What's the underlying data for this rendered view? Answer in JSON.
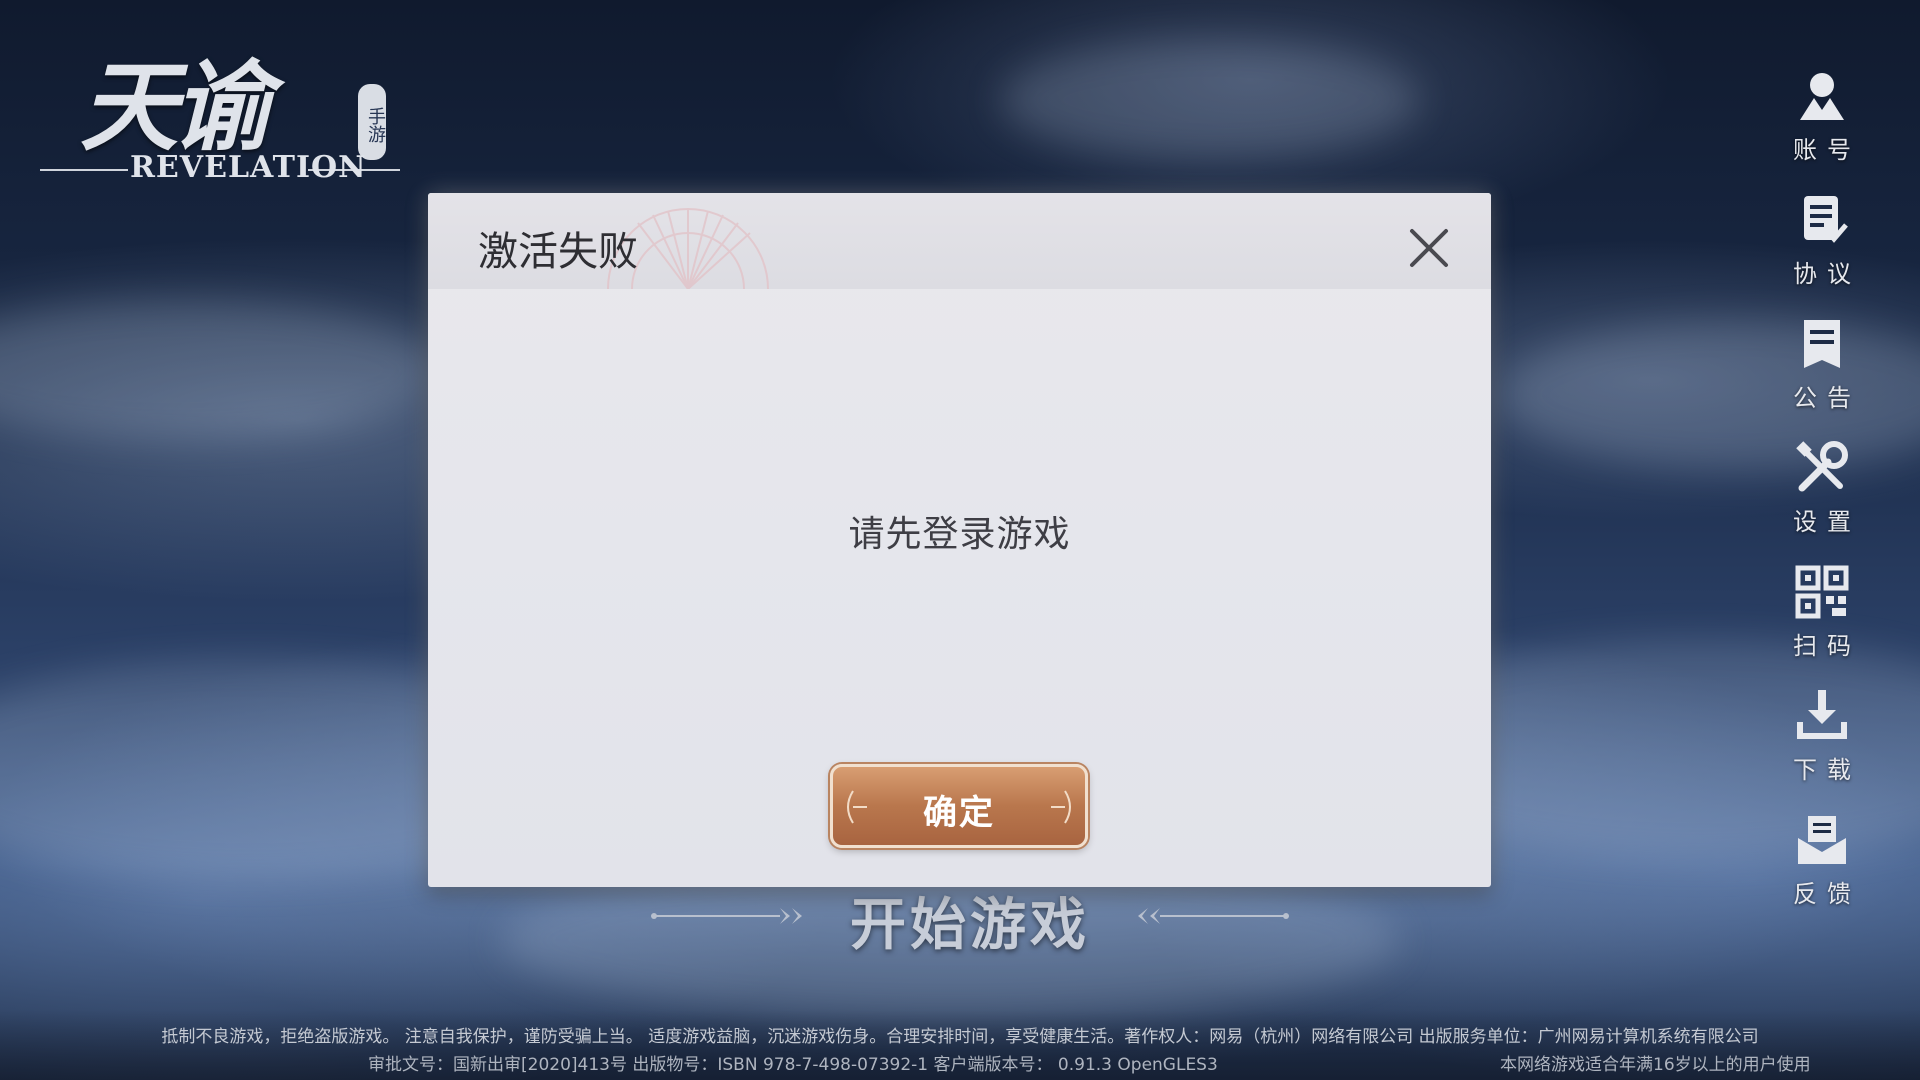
{
  "logo": {
    "title": "天谕",
    "badge": "手游",
    "subtitle": "REVELATION"
  },
  "side_menu": [
    {
      "label": "账号",
      "icon": "account-icon"
    },
    {
      "label": "协议",
      "icon": "agreement-icon"
    },
    {
      "label": "公告",
      "icon": "announcement-icon"
    },
    {
      "label": "设置",
      "icon": "settings-icon"
    },
    {
      "label": "扫码",
      "icon": "qrcode-icon"
    },
    {
      "label": "下载",
      "icon": "download-icon"
    },
    {
      "label": "反馈",
      "icon": "feedback-icon"
    }
  ],
  "start": {
    "label": "开始游戏"
  },
  "dialog": {
    "title": "激活失败",
    "message": "请先登录游戏",
    "confirm_label": "确定",
    "close_icon": "close-icon"
  },
  "footer": {
    "line1": "抵制不良游戏，拒绝盗版游戏。 注意自我保护，谨防受骗上当。 适度游戏益脑，沉迷游戏伤身。合理安排时间，享受健康生活。著作权人：网易（杭州）网络有限公司 出版服务单位：广州网易计算机系统有限公司",
    "line2": "审批文号：国新出审[2020]413号 出版物号：ISBN 978-7-498-07392-1  客户端版本号： 0.91.3 OpenGLES3",
    "age_notice": "本网络游戏适合年满16岁以上的用户使用"
  },
  "colors": {
    "dialog_bg": "#e5e6ec",
    "confirm_button": "#b9774d",
    "background": "#1a2a47"
  }
}
